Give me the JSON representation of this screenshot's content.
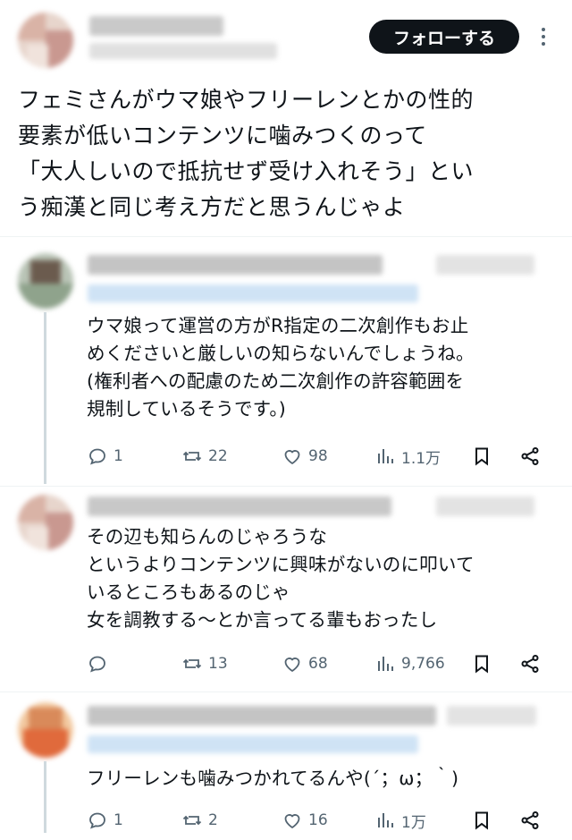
{
  "main_post": {
    "follow_label": "フォローする",
    "text": "フェミさんがウマ娘やフリーレンとかの性的\n要素が低いコンテンツに噛みつくのって\n「大人しいので抵抗せず受け入れそう」とい\nう痴漢と同じ考え方だと思うんじゃよ"
  },
  "replies": [
    {
      "text": "ウマ娘って運営の方がR指定の二次創作もお止\nめくださいと厳しいの知らないんでしょうね。\n(権利者への配慮のため二次創作の許容範囲を\n規制しているそうです。)",
      "replies": "1",
      "reposts": "22",
      "likes": "98",
      "views": "1.1万"
    },
    {
      "text": "その辺も知らんのじゃろうな\nというよりコンテンツに興味がないのに叩いて\nいるところもあるのじゃ\n女を調教する〜とか言ってる輩もおったし",
      "replies": "",
      "reposts": "13",
      "likes": "68",
      "views": "9,766"
    },
    {
      "text": "フリーレンも噛みつかれてるんや(´；ω；｀)",
      "replies": "1",
      "reposts": "2",
      "likes": "16",
      "views": "1万"
    }
  ],
  "icons": {
    "reply": "comment-icon",
    "repost": "repost-icon",
    "like": "heart-icon",
    "views": "analytics-icon",
    "bookmark": "bookmark-icon",
    "share": "share-icon",
    "more": "more-dots-icon"
  },
  "colors": {
    "text": "#0f1419",
    "muted": "#536471",
    "follow_bg": "#0f1419",
    "link_blur": "#cfe3f5",
    "thread_line": "#cfd9de"
  }
}
